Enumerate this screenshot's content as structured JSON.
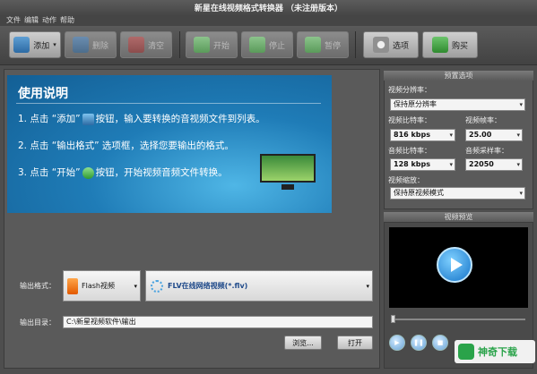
{
  "window": {
    "title": "新星在线视频格式转换器 （未注册版本）"
  },
  "menu": [
    "文件",
    "编辑",
    "动作",
    "帮助"
  ],
  "toolbar": {
    "add_label": "添加",
    "delete_label": "删除",
    "clear_label": "清空",
    "start_label": "开始",
    "stop_label": "停止",
    "pause_label": "暂停",
    "options_label": "选项",
    "buy_label": "购买"
  },
  "instructions": {
    "title": "使用说明",
    "step1_a": "1. 点击 “添加”",
    "step1_b": "按钮，输入要转换的音视频文件到列表。",
    "step2": "2. 点击 “输出格式” 选项框，选择您要输出的格式。",
    "step3_a": "3. 点击 “开始”",
    "step3_b": "按钮，开始视频音频文件转换。"
  },
  "output": {
    "format_label": "输出格式：",
    "format_category": "Flash视频",
    "format_value": "FLV在线网络视频(*.flv)",
    "dir_label": "输出目录：",
    "dir_value": "C:\\新星视频软件\\输出",
    "browse_label": "浏览...",
    "open_label": "打开"
  },
  "preset": {
    "header": "预置选项",
    "resolution_label": "视频分辨率：",
    "resolution_value": "保持原分辨率",
    "vbitrate_label": "视频比特率：",
    "vbitrate_value": "816 kbps",
    "framerate_label": "视频帧率：",
    "framerate_value": "25.00",
    "abitrate_label": "音频比特率：",
    "abitrate_value": "128 kbps",
    "samplerate_label": "音频采样率：",
    "samplerate_value": "22050",
    "scale_label": "视频缩放：",
    "scale_value": "保持原视频模式"
  },
  "preview": {
    "header": "视频预览"
  },
  "watermark": {
    "text": "神奇下载"
  },
  "colors": {
    "accent": "#1f7cb7",
    "watermark": "#2aa34a"
  },
  "icons": [
    "add-icon",
    "delete-icon",
    "clear-icon",
    "start-icon",
    "stop-icon",
    "pause-icon",
    "options-icon",
    "buy-icon",
    "flash-icon",
    "play-icon"
  ]
}
